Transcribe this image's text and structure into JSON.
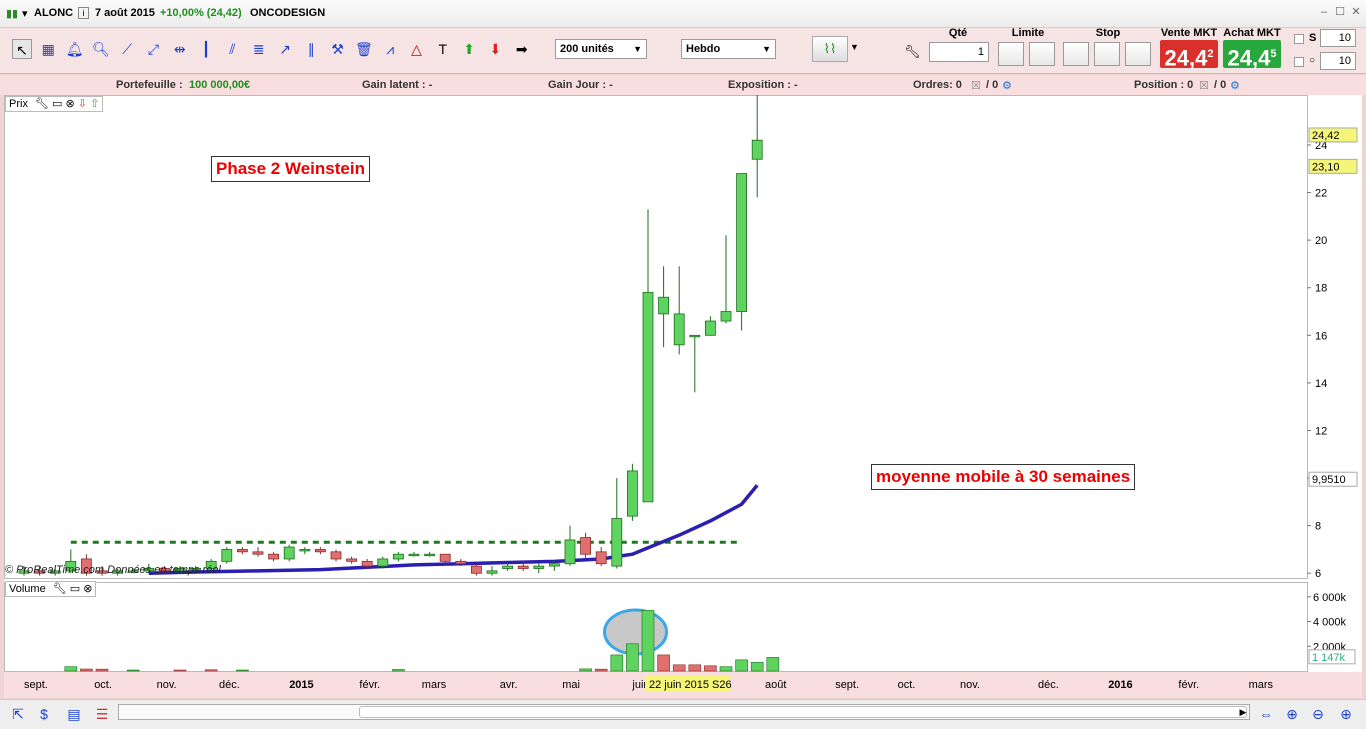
{
  "title_bar": {
    "symbol": "ALONC",
    "date": "7 août 2015",
    "change": "+10,00% (24,42)",
    "company": "ONCODESIGN"
  },
  "toolbar": {
    "quantity_select": "200 unités",
    "period_select": "Hebdo",
    "tools": [
      "cursor-icon",
      "ruler-icon",
      "alarm-bell-icon",
      "magnifier-icon",
      "trendline-icon",
      "ray-icon",
      "horizontal-line-icon",
      "vertical-line-icon",
      "channel-icon",
      "fibonacci-icon",
      "arrow-icon",
      "parallel-icon",
      "hammer-icon",
      "trash-icon",
      "pattern-icon",
      "triangle-icon",
      "text-icon",
      "up-arrow-icon",
      "down-arrow-icon",
      "right-arrow-icon"
    ]
  },
  "order_panel": {
    "qty_label": "Qté",
    "qty_value": "1",
    "limit_label": "Limite",
    "stop_label": "Stop",
    "sell_label": "Vente MKT",
    "buy_label": "Achat MKT",
    "sell_price": "24,4",
    "sell_sup": "2",
    "buy_price": "24,4",
    "buy_sup": "5",
    "s_label": "S",
    "s_value": "10",
    "a_value": "10",
    "sell_color": "#d9302c",
    "buy_color": "#27a83c"
  },
  "info_bar": {
    "portfolio_label": "Portefeuille :",
    "portfolio_value": "100 000,00€",
    "gain_latent": "Gain latent : -",
    "gain_jour": "Gain Jour : -",
    "exposition": "Exposition : -",
    "ordres": "Ordres: 0",
    "ordres_sep": "/ 0",
    "position": "Position : 0",
    "position_sep": "/ 0"
  },
  "panes": {
    "price_label": "Prix",
    "volume_label": "Volume",
    "annotation_phase": "Phase 2 Weinstein",
    "annotation_ma": "moyenne mobile à 30 semaines",
    "copyright": "© ProRealTime.com  Données en temps réel",
    "crosshair_label": "22 juin 2015 S26"
  },
  "chart_data": {
    "type": "candlestick",
    "timeframe": "weekly",
    "y_axis": {
      "ticks": [
        6,
        8,
        10,
        12,
        14,
        16,
        18,
        20,
        22,
        24
      ],
      "ylim": [
        5.8,
        26.1
      ]
    },
    "price_labels": [
      {
        "text": "24,42",
        "value": 24.42,
        "color": "#f5f57a"
      },
      {
        "text": "23,10",
        "value": 23.1,
        "color": "#f5f57a"
      },
      {
        "text": "9,9510",
        "value": 9.951,
        "color": "#ffffff"
      }
    ],
    "x_axis_labels": [
      {
        "label": "sept.",
        "week": 0
      },
      {
        "label": "oct.",
        "week": 4.5
      },
      {
        "label": "nov.",
        "week": 8.5
      },
      {
        "label": "déc.",
        "week": 12.5
      },
      {
        "label": "2015",
        "week": 17,
        "bold": true
      },
      {
        "label": "févr.",
        "week": 21.5
      },
      {
        "label": "mars",
        "week": 25.5
      },
      {
        "label": "avr.",
        "week": 30.5
      },
      {
        "label": "mai",
        "week": 34.5
      },
      {
        "label": "juin",
        "week": 39
      },
      {
        "label": "août",
        "week": 47.5
      },
      {
        "label": "sept.",
        "week": 52
      },
      {
        "label": "oct.",
        "week": 56
      },
      {
        "label": "nov.",
        "week": 60
      },
      {
        "label": "déc.",
        "week": 65
      },
      {
        "label": "2016",
        "week": 69.5,
        "bold": true
      },
      {
        "label": "févr.",
        "week": 74
      },
      {
        "label": "mars",
        "week": 78.5
      }
    ],
    "candles": [
      {
        "w": 0,
        "o": 6.0,
        "h": 6.3,
        "l": 5.9,
        "c": 6.1
      },
      {
        "w": 1,
        "o": 6.1,
        "h": 6.3,
        "l": 5.9,
        "c": 6.0
      },
      {
        "w": 2,
        "o": 6.0,
        "h": 6.2,
        "l": 5.9,
        "c": 6.1
      },
      {
        "w": 3,
        "o": 6.1,
        "h": 7.0,
        "l": 6.0,
        "c": 6.5
      },
      {
        "w": 4,
        "o": 6.6,
        "h": 6.8,
        "l": 5.9,
        "c": 6.0
      },
      {
        "w": 5,
        "o": 6.1,
        "h": 6.3,
        "l": 5.9,
        "c": 6.0
      },
      {
        "w": 6,
        "o": 6.0,
        "h": 6.2,
        "l": 5.9,
        "c": 6.1
      },
      {
        "w": 7,
        "o": 6.1,
        "h": 6.2,
        "l": 6.0,
        "c": 6.1
      },
      {
        "w": 8,
        "o": 6.1,
        "h": 6.4,
        "l": 6.0,
        "c": 6.2
      },
      {
        "w": 9,
        "o": 6.2,
        "h": 6.3,
        "l": 6.0,
        "c": 6.1
      },
      {
        "w": 10,
        "o": 6.1,
        "h": 6.3,
        "l": 6.0,
        "c": 6.2
      },
      {
        "w": 11,
        "o": 6.2,
        "h": 6.3,
        "l": 6.1,
        "c": 6.2
      },
      {
        "w": 12,
        "o": 6.2,
        "h": 6.6,
        "l": 6.1,
        "c": 6.5
      },
      {
        "w": 13,
        "o": 6.5,
        "h": 7.1,
        "l": 6.4,
        "c": 7.0
      },
      {
        "w": 14,
        "o": 7.0,
        "h": 7.1,
        "l": 6.8,
        "c": 6.9
      },
      {
        "w": 15,
        "o": 6.9,
        "h": 7.1,
        "l": 6.7,
        "c": 6.8
      },
      {
        "w": 16,
        "o": 6.8,
        "h": 6.9,
        "l": 6.5,
        "c": 6.6
      },
      {
        "w": 17,
        "o": 6.6,
        "h": 7.2,
        "l": 6.5,
        "c": 7.1
      },
      {
        "w": 18,
        "o": 7.0,
        "h": 7.1,
        "l": 6.8,
        "c": 7.0
      },
      {
        "w": 19,
        "o": 7.0,
        "h": 7.1,
        "l": 6.8,
        "c": 6.9
      },
      {
        "w": 20,
        "o": 6.9,
        "h": 7.0,
        "l": 6.5,
        "c": 6.6
      },
      {
        "w": 21,
        "o": 6.6,
        "h": 6.7,
        "l": 6.4,
        "c": 6.5
      },
      {
        "w": 22,
        "o": 6.5,
        "h": 6.6,
        "l": 6.2,
        "c": 6.3
      },
      {
        "w": 23,
        "o": 6.3,
        "h": 6.7,
        "l": 6.2,
        "c": 6.6
      },
      {
        "w": 24,
        "o": 6.6,
        "h": 6.9,
        "l": 6.5,
        "c": 6.8
      },
      {
        "w": 25,
        "o": 6.8,
        "h": 6.9,
        "l": 6.7,
        "c": 6.8
      },
      {
        "w": 26,
        "o": 6.8,
        "h": 6.9,
        "l": 6.7,
        "c": 6.8
      },
      {
        "w": 27,
        "o": 6.8,
        "h": 6.8,
        "l": 6.4,
        "c": 6.5
      },
      {
        "w": 28,
        "o": 6.5,
        "h": 6.6,
        "l": 6.3,
        "c": 6.4
      },
      {
        "w": 29,
        "o": 6.3,
        "h": 6.4,
        "l": 5.9,
        "c": 6.0
      },
      {
        "w": 30,
        "o": 6.0,
        "h": 6.3,
        "l": 5.9,
        "c": 6.1
      },
      {
        "w": 31,
        "o": 6.2,
        "h": 6.4,
        "l": 6.1,
        "c": 6.3
      },
      {
        "w": 32,
        "o": 6.3,
        "h": 6.5,
        "l": 6.1,
        "c": 6.2
      },
      {
        "w": 33,
        "o": 6.2,
        "h": 6.4,
        "l": 6.0,
        "c": 6.3
      },
      {
        "w": 34,
        "o": 6.3,
        "h": 6.5,
        "l": 6.1,
        "c": 6.4
      },
      {
        "w": 35,
        "o": 6.4,
        "h": 8.0,
        "l": 6.3,
        "c": 7.4
      },
      {
        "w": 36,
        "o": 7.5,
        "h": 7.7,
        "l": 6.6,
        "c": 6.8
      },
      {
        "w": 37,
        "o": 6.9,
        "h": 7.1,
        "l": 6.3,
        "c": 6.4
      },
      {
        "w": 38,
        "o": 6.3,
        "h": 10.0,
        "l": 6.2,
        "c": 8.3
      },
      {
        "w": 39,
        "o": 8.4,
        "h": 10.6,
        "l": 8.2,
        "c": 10.3
      },
      {
        "w": 40,
        "o": 9.0,
        "h": 21.3,
        "l": 9.0,
        "c": 17.8
      },
      {
        "w": 41,
        "o": 16.9,
        "h": 18.9,
        "l": 15.5,
        "c": 17.6
      },
      {
        "w": 42,
        "o": 15.6,
        "h": 18.9,
        "l": 15.2,
        "c": 16.9
      },
      {
        "w": 43,
        "o": 16.0,
        "h": 16.0,
        "l": 13.6,
        "c": 16.0
      },
      {
        "w": 44,
        "o": 16.0,
        "h": 16.8,
        "l": 16.0,
        "c": 16.6
      },
      {
        "w": 45,
        "o": 16.6,
        "h": 20.2,
        "l": 16.5,
        "c": 17.0
      },
      {
        "w": 46,
        "o": 17.0,
        "h": 22.8,
        "l": 16.2,
        "c": 22.8
      },
      {
        "w": 47,
        "o": 23.4,
        "h": 26.1,
        "l": 21.8,
        "c": 24.2
      }
    ],
    "moving_average": {
      "period_weeks": 30,
      "color": "#2a1fb0",
      "points": [
        [
          8,
          6.0
        ],
        [
          11,
          6.05
        ],
        [
          15,
          6.1
        ],
        [
          19,
          6.15
        ],
        [
          22,
          6.25
        ],
        [
          25,
          6.35
        ],
        [
          28,
          6.4
        ],
        [
          31,
          6.45
        ],
        [
          34,
          6.5
        ],
        [
          37,
          6.6
        ],
        [
          39,
          6.8
        ],
        [
          42,
          7.6
        ],
        [
          44,
          8.2
        ],
        [
          46,
          8.9
        ],
        [
          47,
          9.7
        ]
      ]
    },
    "resistance_line": {
      "value": 7.3,
      "from_week": 3,
      "to_week": 46,
      "color": "#1f7a1f"
    },
    "volume": {
      "y_ticks": [
        {
          "label": "6 000k",
          "value": 6000
        },
        {
          "label": "4 000k",
          "value": 4000
        },
        {
          "label": "2 000k",
          "value": 2000
        }
      ],
      "last_label": "1 147k",
      "ylim": [
        0,
        7200
      ],
      "bars": [
        {
          "w": 3,
          "v": 350,
          "up": true
        },
        {
          "w": 4,
          "v": 160,
          "up": false
        },
        {
          "w": 5,
          "v": 150,
          "up": false
        },
        {
          "w": 7,
          "v": 80,
          "up": true
        },
        {
          "w": 10,
          "v": 80,
          "up": false
        },
        {
          "w": 12,
          "v": 100,
          "up": false
        },
        {
          "w": 14,
          "v": 80,
          "up": true
        },
        {
          "w": 24,
          "v": 120,
          "up": true
        },
        {
          "w": 36,
          "v": 170,
          "up": true
        },
        {
          "w": 37,
          "v": 150,
          "up": false
        },
        {
          "w": 38,
          "v": 1300,
          "up": true
        },
        {
          "w": 39,
          "v": 2200,
          "up": true
        },
        {
          "w": 40,
          "v": 4900,
          "up": true
        },
        {
          "w": 41,
          "v": 1300,
          "up": false
        },
        {
          "w": 42,
          "v": 500,
          "up": false
        },
        {
          "w": 43,
          "v": 500,
          "up": false
        },
        {
          "w": 44,
          "v": 420,
          "up": false
        },
        {
          "w": 45,
          "v": 350,
          "up": true
        },
        {
          "w": 46,
          "v": 900,
          "up": true
        },
        {
          "w": 47,
          "v": 700,
          "up": true
        },
        {
          "w": 48,
          "v": 1100,
          "up": true
        }
      ]
    },
    "colors": {
      "up": "#5fd35f",
      "down": "#e07070",
      "up_border": "#1c6e1c",
      "down_border": "#8a2a2a"
    }
  }
}
